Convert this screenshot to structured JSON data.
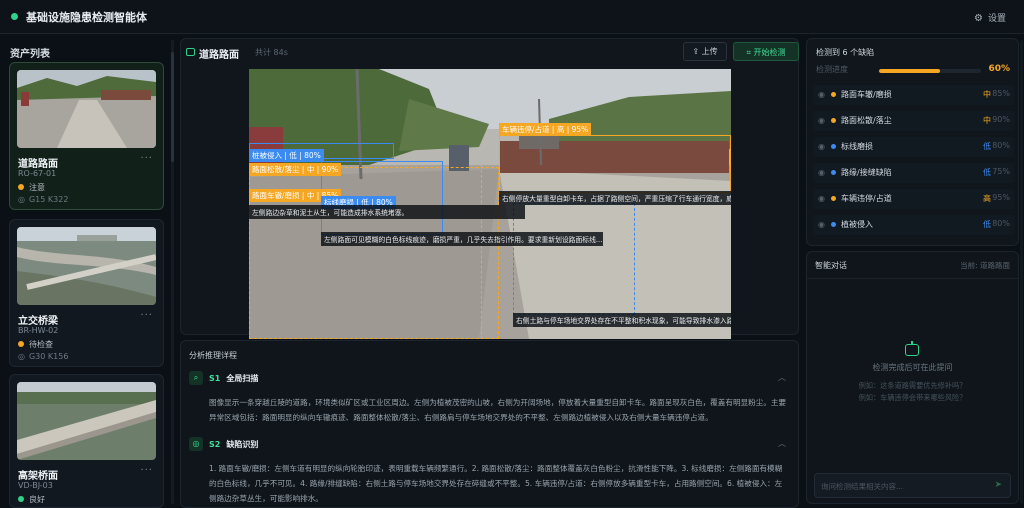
{
  "app": {
    "title": "基础设施隐患检测智能体",
    "settings_label": "设置"
  },
  "sidebar": {
    "title": "资产列表",
    "assets": [
      {
        "name": "道路路面",
        "code": "RO-67-01",
        "status": "注意",
        "status_color": "#f5a623",
        "location": "G15 K322"
      },
      {
        "name": "立交桥梁",
        "code": "BR-HW-02",
        "status": "待检查",
        "status_color": "#f5a623",
        "location": "G30 K156"
      },
      {
        "name": "高架桥面",
        "code": "VD-BJ-03",
        "status": "良好",
        "status_color": "#2fd28a",
        "location": ""
      }
    ]
  },
  "viewer": {
    "title": "道路路面",
    "subtitle": "共计 84s",
    "upload_label": "上传",
    "detect_label": "开始检测",
    "detections": [
      {
        "label": "桩被侵入 | 低 | 80%",
        "desc": ""
      },
      {
        "label": "路面松散/落尘 | 中 | 90%",
        "desc": "左侧路边杂草和泥土从生，可能造成排水系统堵塞。"
      },
      {
        "label": "路面车辙/磨损 | 中 | 85%",
        "desc": ""
      },
      {
        "label": "标线磨损 | 低 | 80%",
        "desc": "左侧路面可见模糊的白色标线痕迹，磨损严重，几乎失去指引作用。要求重新划设路面标线..."
      },
      {
        "label": "车辆违停/占道 | 高 | 95%",
        "desc": "右侧停放大量重型自卸卡车，占据了路侧空间，严重压缩了行车通行宽度，威..."
      },
      {
        "label": "",
        "desc": "右侧土路与停车场地交界处存在不平整和积水现象，可能导致排水渗入路..."
      }
    ]
  },
  "analysis": {
    "title": "分析推理详程",
    "steps": [
      {
        "num": "S1",
        "title": "全局扫描",
        "text": "图像显示一条穿越丘陵的道路，环境类似矿区或工业区周边。左侧为植被茂密的山坡，右侧为开阔场地，停放着大量重型自卸卡车。路面呈现灰白色，覆盖有明显粉尘。主要异常区域包括：路面明显的纵向车辙痕迹、路面整体松散/落尘、右侧路肩与停车场地交界处的不平整、左侧路边植被侵入以及右侧大量车辆违停占道。"
      },
      {
        "num": "S2",
        "title": "缺陷识别",
        "text": "1. 路面车辙/磨损：左侧车道有明显的纵向轮胎印迹，表明重载车辆频繁通行。2. 路面松散/落尘：路面整体覆盖灰白色粉尘，抗滑性能下降。3. 标线磨损：左侧路面有模糊的白色标线，几乎不可见。4. 路缘/排缝缺陷：右侧土路与停车场地交界处存在碎缝或不平整。5. 车辆违停/占道：右侧停放多辆重型卡车，占用路侧空间。6. 植被侵入：左侧路边杂草丛生，可能影响排水。"
      }
    ]
  },
  "defects_panel": {
    "header": "检测到 6 个缺陷",
    "progress_label": "检测进度",
    "progress_pct": 60,
    "progress_text": "60%",
    "items": [
      {
        "name": "路面车辙/磨损",
        "severity": "中",
        "confidence": "85%",
        "color": "#f5a623"
      },
      {
        "name": "路面松散/落尘",
        "severity": "中",
        "confidence": "90%",
        "color": "#f5a623"
      },
      {
        "name": "标线磨损",
        "severity": "低",
        "confidence": "80%",
        "color": "#3b8bf0"
      },
      {
        "name": "路缘/接缝缺陷",
        "severity": "低",
        "confidence": "75%",
        "color": "#3b8bf0"
      },
      {
        "name": "车辆违停/占道",
        "severity": "高",
        "confidence": "95%",
        "color": "#f5a623"
      },
      {
        "name": "植被侵入",
        "severity": "低",
        "confidence": "80%",
        "color": "#3b8bf0"
      }
    ]
  },
  "chat": {
    "title": "智能对话",
    "current": "当前: 道路路面",
    "empty_main": "检测完成后可在此提问",
    "empty_tip_1": "例如：这条道路需要优先修补吗？",
    "empty_tip_2": "例如：车辆违停会带来哪些风险？",
    "input_placeholder": "询问检测结果相关内容..."
  }
}
